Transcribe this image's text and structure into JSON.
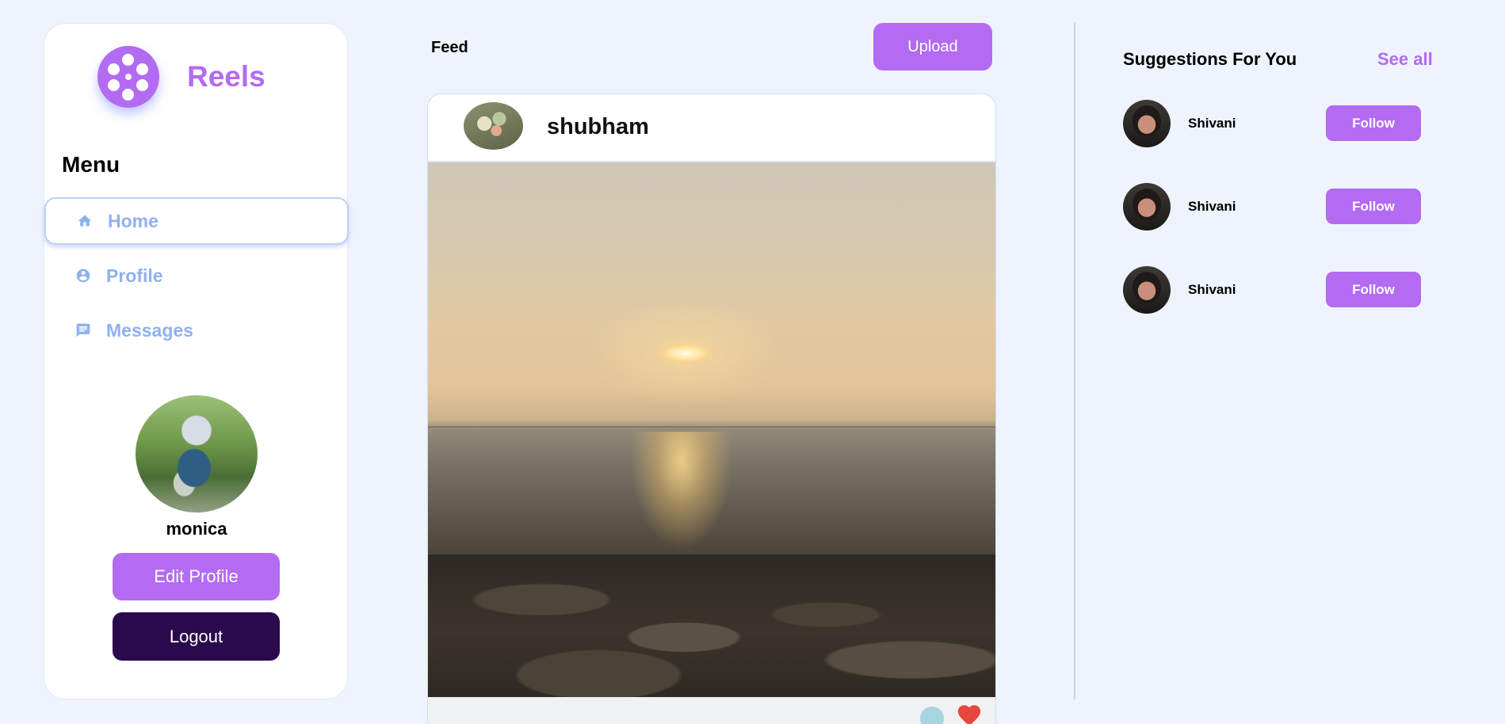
{
  "brand": {
    "name": "Reels",
    "color": "#b36bf2",
    "logo_icon": "film-reel-icon"
  },
  "menu": {
    "title": "Menu",
    "items": [
      {
        "label": "Home",
        "icon": "home-icon",
        "active": true
      },
      {
        "label": "Profile",
        "icon": "account-circle-icon",
        "active": false
      },
      {
        "label": "Messages",
        "icon": "message-icon",
        "active": false
      }
    ]
  },
  "profile": {
    "username": "monica",
    "edit_label": "Edit Profile",
    "logout_label": "Logout"
  },
  "feed": {
    "title": "Feed",
    "upload_label": "Upload",
    "post": {
      "user": "shubham",
      "media": "sunset-over-sea-video",
      "actions": [
        "comment-icon",
        "heart-icon"
      ]
    }
  },
  "suggestions": {
    "title": "Suggestions For You",
    "see_all_label": "See all",
    "items": [
      {
        "name": "Shivani",
        "follow_label": "Follow"
      },
      {
        "name": "Shivani",
        "follow_label": "Follow"
      },
      {
        "name": "Shivani",
        "follow_label": "Follow"
      }
    ]
  },
  "colors": {
    "background": "#eff3fd",
    "accent": "#b36bf2",
    "nav_text": "#8fb1ee",
    "logout_bg": "#2a0a4d",
    "heart": "#e8453c"
  }
}
